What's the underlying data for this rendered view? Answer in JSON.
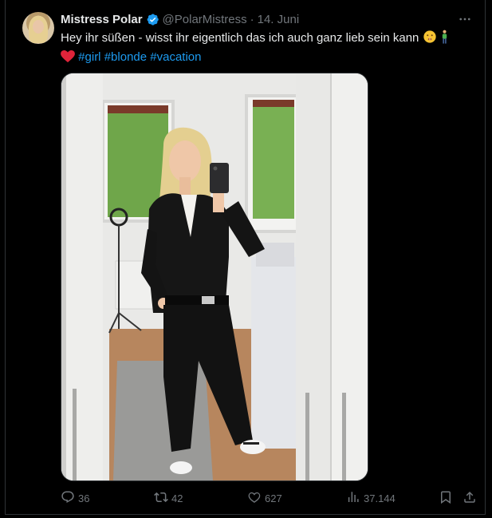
{
  "tweet": {
    "author_name": "Mistress Polar",
    "handle": "@PolarMistress",
    "separator": "·",
    "date": "14. Juni",
    "text_line1": "Hey ihr süßen - wisst ihr eigentlich das ich auch ganz lieb sein kann",
    "hashtags": [
      "#girl",
      "#blonde",
      "#vacation"
    ],
    "media_alt": "",
    "verified_color": "#1d9bf0",
    "accent_color": "#1d9bf0"
  },
  "actions": {
    "replies": "36",
    "retweets": "42",
    "likes": "627",
    "views": "37.144"
  },
  "icons": {
    "more": "more-horizontal-icon",
    "reply": "reply-icon",
    "retweet": "retweet-icon",
    "like": "heart-icon",
    "views": "views-chart-icon",
    "bookmark": "bookmark-icon",
    "share": "share-icon"
  }
}
